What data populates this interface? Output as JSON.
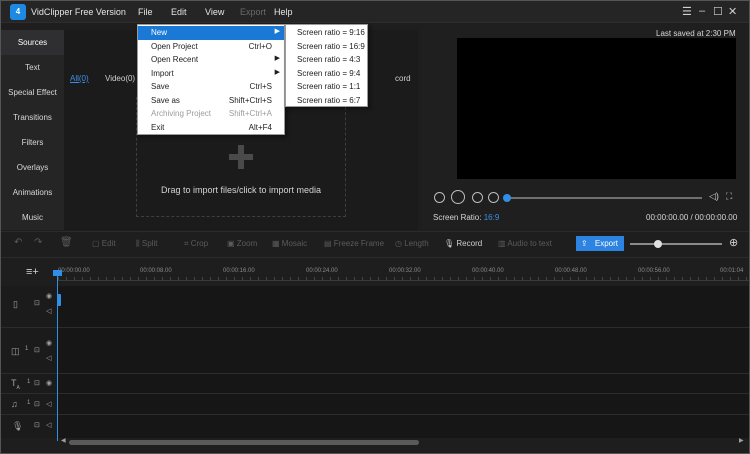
{
  "app": {
    "title": "VidClipper Free Version",
    "logo_text": "4",
    "last_saved": "Last saved at 2:30 PM",
    "accent": "#2c83e1"
  },
  "menubar": {
    "file": "File",
    "edit": "Edit",
    "view": "View",
    "export": "Export",
    "help": "Help"
  },
  "window_controls": {
    "menu": "☰",
    "minimize": "–",
    "maximize": "☐",
    "close": "✕"
  },
  "sidebar": {
    "items": [
      {
        "label": "Sources"
      },
      {
        "label": "Text"
      },
      {
        "label": "Special Effect"
      },
      {
        "label": "Transitions"
      },
      {
        "label": "Filters"
      },
      {
        "label": "Overlays"
      },
      {
        "label": "Animations"
      },
      {
        "label": "Music"
      }
    ]
  },
  "media": {
    "tabs": [
      {
        "label": "All(0)"
      },
      {
        "label": "Video(0)"
      },
      {
        "label": "cord"
      }
    ],
    "drop_text": "Drag to import files/click to import media"
  },
  "file_menu": {
    "items": [
      {
        "label": "New",
        "shortcut": "",
        "arrow": "▶"
      },
      {
        "label": "Open Project",
        "shortcut": "Ctrl+O",
        "arrow": ""
      },
      {
        "label": "Open Recent",
        "shortcut": "",
        "arrow": "▶"
      },
      {
        "label": "Import",
        "shortcut": "",
        "arrow": "▶"
      },
      {
        "label": "Save",
        "shortcut": "Ctrl+S",
        "arrow": ""
      },
      {
        "label": "Save as",
        "shortcut": "Shift+Ctrl+S",
        "arrow": ""
      },
      {
        "label": "Archiving Project",
        "shortcut": "Shift+Ctrl+A",
        "arrow": ""
      },
      {
        "label": "Exit",
        "shortcut": "Alt+F4",
        "arrow": ""
      }
    ]
  },
  "new_submenu": {
    "items": [
      {
        "label": "Screen ratio = 9:16"
      },
      {
        "label": "Screen ratio = 16:9"
      },
      {
        "label": "Screen ratio = 4:3"
      },
      {
        "label": "Screen ratio = 9:4"
      },
      {
        "label": "Screen ratio = 1:1"
      },
      {
        "label": "Screen ratio = 6:7"
      }
    ]
  },
  "preview": {
    "ratio_label": "Screen Ratio:",
    "ratio_value": "16:9",
    "timecode": "00:00:00.00 / 00:00:00.00",
    "seek_progress": 0
  },
  "toolbar": {
    "edit": "Edit",
    "split": "Split",
    "crop": "Crop",
    "zoom": "Zoom",
    "mosaic": "Mosaic",
    "freeze_frame": "Freeze Frame",
    "length": "Length",
    "record": "Record",
    "audio_to_text": "Audio to text",
    "export": "Export"
  },
  "timeline": {
    "ticks": [
      "00:00:00.00",
      "00:00:08.00",
      "00:00:16.00",
      "00:00:24.00",
      "00:00:32.00",
      "00:00:40.00",
      "00:00:48.00",
      "00:00:56.00",
      "00:01:04"
    ],
    "track_number": "1"
  }
}
